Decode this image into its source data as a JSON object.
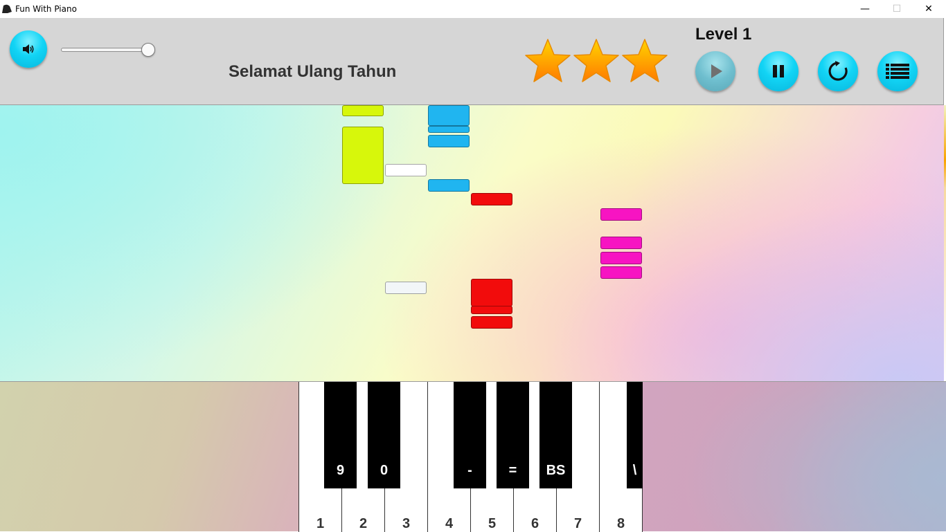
{
  "window": {
    "title": "Fun With Piano",
    "minimize": "—",
    "maximize": "☐",
    "close": "✕"
  },
  "toolbar": {
    "volume_icon": "speaker-icon",
    "volume_level": 0.95,
    "song_title": "Selamat Ulang Tahun",
    "level": "Level 1",
    "stars_earned": 3,
    "stars_total": 3,
    "buttons": [
      "play-button",
      "pause-button",
      "restart-button",
      "menu-button"
    ]
  },
  "colors": {
    "accent": "#12d4f5",
    "star": "#ffa500",
    "note_yellow": "#d7f70b",
    "note_blue": "#20b5f0",
    "note_white": "#ffffff",
    "note_red": "#f20c0c",
    "note_pink": "#f714c2"
  },
  "piano": {
    "white_keys": [
      "1",
      "2",
      "3",
      "4",
      "5",
      "6",
      "7",
      "8"
    ],
    "black_keys": [
      "9",
      "0",
      "-",
      "=",
      "BS",
      "\\"
    ]
  }
}
